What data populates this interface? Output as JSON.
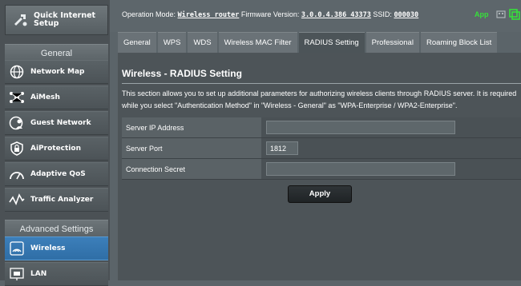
{
  "sidebar": {
    "quick_setup": "Quick Internet\nSetup",
    "general_head": "General",
    "general_items": [
      {
        "label": "Network Map",
        "icon": "globe-icon"
      },
      {
        "label": "AiMesh",
        "icon": "aimesh-icon"
      },
      {
        "label": "Guest Network",
        "icon": "guest-network-icon"
      },
      {
        "label": "AiProtection",
        "icon": "lock-shield-icon"
      },
      {
        "label": "Adaptive QoS",
        "icon": "speedometer-icon"
      },
      {
        "label": "Traffic Analyzer",
        "icon": "traffic-analyzer-icon"
      }
    ],
    "advanced_head": "Advanced Settings",
    "advanced_items": [
      {
        "label": "Wireless",
        "icon": "wifi-icon",
        "active": true
      },
      {
        "label": "LAN",
        "icon": "lan-icon"
      }
    ]
  },
  "header": {
    "op_mode_label": "Operation Mode:",
    "op_mode": "Wireless router",
    "fw_label": "Firmware Version:",
    "fw": "3.0.0.4.386_43373",
    "ssid_label": "SSID:",
    "ssid": "000030",
    "app": "App"
  },
  "tabs": [
    "General",
    "WPS",
    "WDS",
    "Wireless MAC Filter",
    "RADIUS Setting",
    "Professional",
    "Roaming Block List"
  ],
  "active_tab": "RADIUS Setting",
  "content": {
    "title": "Wireless - RADIUS Setting",
    "description": "This section allows you to set up additional parameters for authorizing wireless clients through RADIUS server. It is required while you select \"Authentication Method\" in \"Wireless - General\" as \"WPA-Enterprise / WPA2-Enterprise\".",
    "fields": [
      {
        "label": "Server IP Address",
        "value": ""
      },
      {
        "label": "Server Port",
        "value": "1812"
      },
      {
        "label": "Connection Secret",
        "value": ""
      }
    ],
    "apply": "Apply"
  },
  "colors": {
    "accent": "#2f6ea6",
    "app_green": "#36e03a"
  }
}
